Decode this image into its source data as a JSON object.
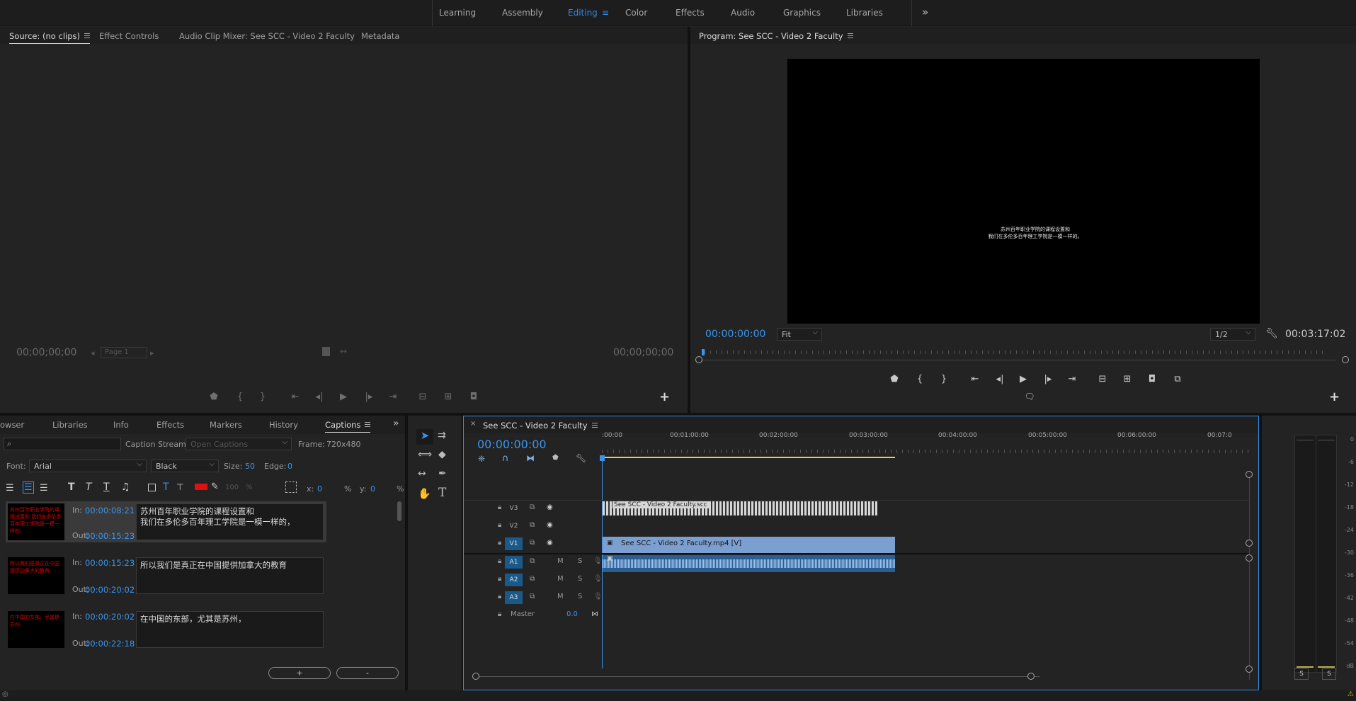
{
  "workspaces": {
    "items": [
      {
        "label": "Learning"
      },
      {
        "label": "Assembly"
      },
      {
        "label": "Editing"
      },
      {
        "label": "Color"
      },
      {
        "label": "Effects"
      },
      {
        "label": "Audio"
      },
      {
        "label": "Graphics"
      },
      {
        "label": "Libraries"
      }
    ],
    "more": "»"
  },
  "source_panel": {
    "tabs": [
      "Source: (no clips)",
      "Effect Controls",
      "Audio Clip Mixer: See SCC - Video 2 Faculty",
      "Metadata"
    ],
    "timecode_left": "00;00;00;00",
    "timecode_right": "00;00;00;00",
    "page": "Page 1",
    "add": "+"
  },
  "program_panel": {
    "title": "Program: See SCC - Video 2 Faculty",
    "subtitle_line1": "苏州百年职业学院的课程设置和",
    "subtitle_line2": "我们在多伦多百年理工学院是一模一样的。",
    "timecode": "00:00:00:00",
    "zoom": "Fit",
    "resolution": "1/2",
    "duration": "00:03:17:02",
    "add": "+"
  },
  "captions_panel": {
    "tabs": [
      "owser",
      "Libraries",
      "Info",
      "Effects",
      "Markers",
      "History",
      "Captions"
    ],
    "search_placeholder": "",
    "stream_label": "Caption Stream:",
    "stream_value": "Open Captions",
    "frame_label": "Frame:",
    "frame_value": "720x480",
    "font_label": "Font:",
    "font_value": "Arial",
    "style_value": "Black",
    "size_label": "Size:",
    "size_value": "50",
    "edge_label": "Edge:",
    "edge_value": "0",
    "opacity_value": "100",
    "pct": "%",
    "x_label": "x:",
    "x_value": "0",
    "y_label": "y:",
    "y_value": "0",
    "in_label": "In:",
    "out_label": "Out:",
    "items": [
      {
        "in": "00:00:08:21",
        "out": "00:00:15:23",
        "text": "苏州百年职业学院的课程设置和\n我们在多伦多百年理工学院是一模一样的，"
      },
      {
        "in": "00:00:15:23",
        "out": "00:00:20:02",
        "text": "所以我们是真正在中国提供加拿大的教育"
      },
      {
        "in": "00:00:20:02",
        "out": "00:00:22:18",
        "text": "在中国的东部，尤其是苏州，"
      }
    ],
    "add_button": "+",
    "remove_button": "-"
  },
  "timeline": {
    "title": "See SCC - Video 2 Faculty",
    "timecode": "00:00:00:00",
    "ruler": [
      ":00:00",
      "00:01:00:00",
      "00:02:00:00",
      "00:03:00:00",
      "00:04:00:00",
      "00:05:00:00",
      "00:06:00:00",
      "00:07:0"
    ],
    "tracks": {
      "v3": "V3",
      "v2": "V2",
      "v1": "V1",
      "a1": "A1",
      "a2": "A2",
      "a3": "A3",
      "master": "Master",
      "master_value": "0.0"
    },
    "m": "M",
    "s": "S",
    "clip_caption": "See SCC - Video 2 Faculty.scc",
    "clip_video": "See SCC - Video 2 Faculty.mp4 [V]"
  },
  "meter": {
    "labels": [
      "0",
      "-6",
      "-12",
      "-18",
      "-24",
      "-30",
      "-36",
      "-42",
      "-48",
      "-54",
      "dB"
    ],
    "solo_left": "S",
    "solo_right": "S"
  },
  "colors": {
    "accent": "#2d8ceb",
    "clip_video": "#7c9fd1",
    "clip_audio": "#2d5e93",
    "caption_clip": "#c9c9c9"
  }
}
